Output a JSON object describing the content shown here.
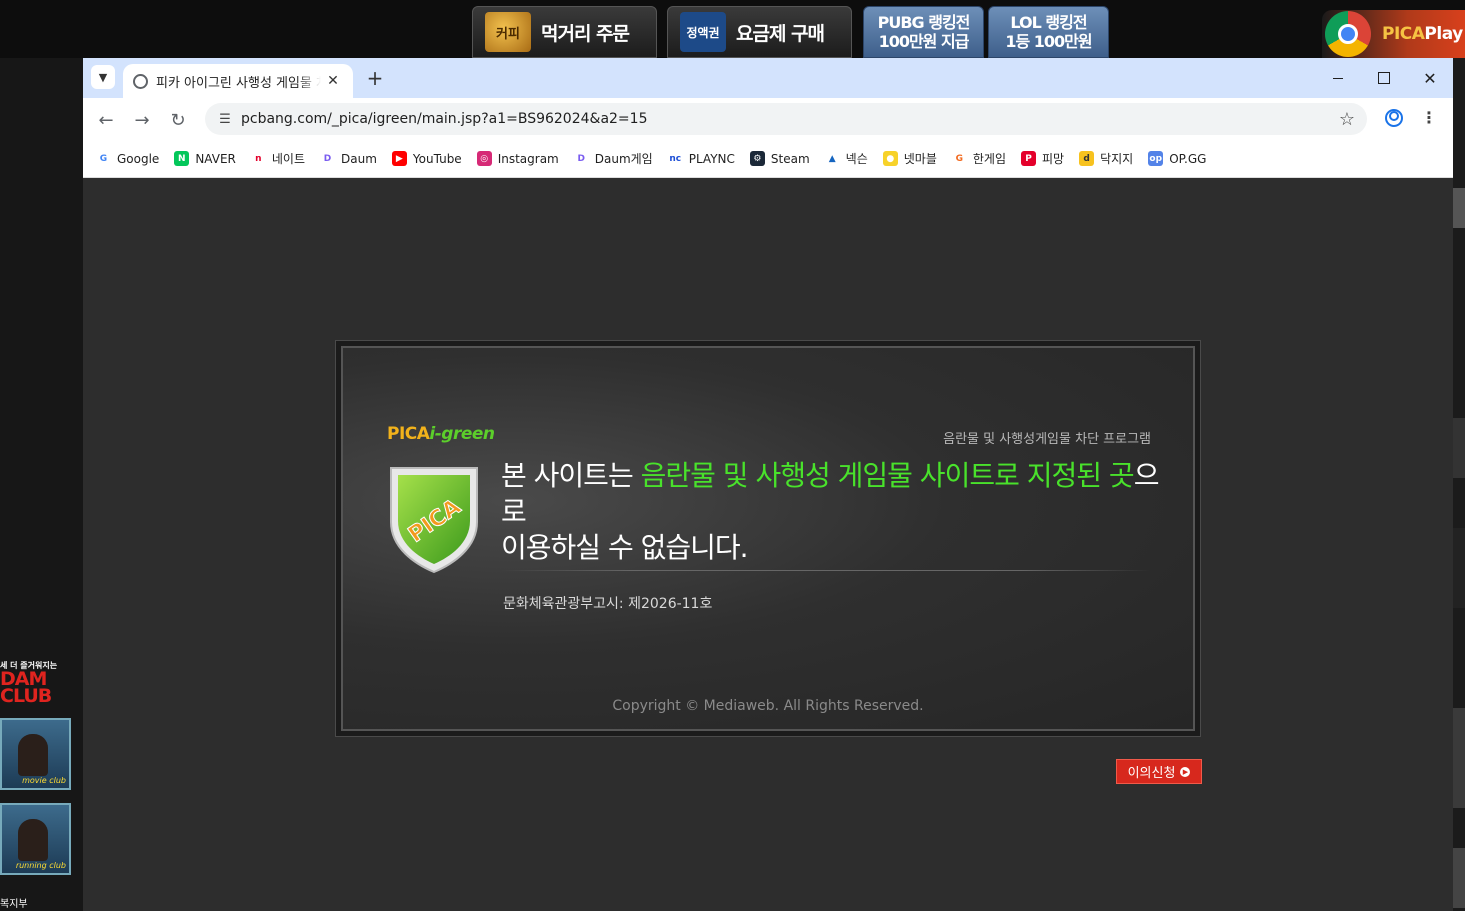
{
  "desktop": {
    "launcher": {
      "food_order_label": "먹거리 주문",
      "food_icon_text": "커피",
      "plan_purchase_label": "요금제 구매",
      "plan_icon_text": "정액권",
      "pubg_line1": "PUBG 랭킹전",
      "pubg_line2": "100만원 지급",
      "lol_line1": "LOL 랭킹전",
      "lol_line2": "1등 100만원",
      "picaplay_prefix": "PICA",
      "picaplay_suffix": "Play"
    },
    "left_ad": {
      "tagline": "세 더 즐거워지는",
      "title_line1": "DAM",
      "title_line2": "CLUB",
      "thumb1_caption": "movie club",
      "thumb2_caption": "running club",
      "bottom_text": "복지부"
    }
  },
  "browser": {
    "tab": {
      "title": "피카 아이그린 사행성 게임물 차단"
    },
    "address": {
      "url": "pcbang.com/_pica/igreen/main.jsp?a1=BS962024&a2=15"
    },
    "bookmarks": [
      {
        "label": "Google",
        "icon": "google-icon",
        "color": "#ffffff",
        "glyph": "G",
        "glyph_color": "#4285f4"
      },
      {
        "label": "NAVER",
        "icon": "naver-icon",
        "color": "#03c75a",
        "glyph": "N",
        "glyph_color": "#ffffff"
      },
      {
        "label": "네이트",
        "icon": "nate-icon",
        "color": "#ffffff",
        "glyph": "n",
        "glyph_color": "#e4002b"
      },
      {
        "label": "Daum",
        "icon": "daum-icon",
        "color": "#ffffff",
        "glyph": "D",
        "glyph_color": "#7a5cf0"
      },
      {
        "label": "YouTube",
        "icon": "youtube-icon",
        "color": "#ff0000",
        "glyph": "▶",
        "glyph_color": "#ffffff"
      },
      {
        "label": "Instagram",
        "icon": "instagram-icon",
        "color": "#d62976",
        "glyph": "◎",
        "glyph_color": "#ffffff"
      },
      {
        "label": "Daum게임",
        "icon": "daum-game-icon",
        "color": "#ffffff",
        "glyph": "D",
        "glyph_color": "#7a5cf0"
      },
      {
        "label": "PLAYNC",
        "icon": "plaync-icon",
        "color": "#ffffff",
        "glyph": "nc",
        "glyph_color": "#1d4fd6"
      },
      {
        "label": "Steam",
        "icon": "steam-icon",
        "color": "#1b2838",
        "glyph": "⚙",
        "glyph_color": "#ffffff"
      },
      {
        "label": "넥슨",
        "icon": "nexon-icon",
        "color": "#ffffff",
        "glyph": "▲",
        "glyph_color": "#1565c0"
      },
      {
        "label": "넷마블",
        "icon": "netmarble-icon",
        "color": "#f7d22a",
        "glyph": "●",
        "glyph_color": "#ffffff"
      },
      {
        "label": "한게임",
        "icon": "hangame-icon",
        "color": "#ffffff",
        "glyph": "G",
        "glyph_color": "#f26b21"
      },
      {
        "label": "피망",
        "icon": "pmang-icon",
        "color": "#e4002b",
        "glyph": "P",
        "glyph_color": "#ffffff"
      },
      {
        "label": "닥지지",
        "icon": "dakgg-icon",
        "color": "#f7c21e",
        "glyph": "d",
        "glyph_color": "#333333"
      },
      {
        "label": "OP.GG",
        "icon": "opgg-icon",
        "color": "#5383e8",
        "glyph": "op",
        "glyph_color": "#ffffff"
      }
    ]
  },
  "page": {
    "logo_prefix": "PICA",
    "logo_suffix": "i-green",
    "program_label": "음란물 및 사행성게임물 차단 프로그램",
    "shield_text": "PICA",
    "message_prefix": "본 사이트는 ",
    "message_highlight": "음란물 및 사행성 게임물 사이트로 지정된 곳",
    "message_suffix": "으로",
    "message_line2": "이용하실 수 없습니다.",
    "notice": "문화체육관광부고시: 제2026-11호",
    "copyright": "Copyright © Mediaweb. All Rights Reserved.",
    "appeal_label": "이의신청",
    "colors": {
      "highlight": "#49e22b",
      "appeal": "#d7281d",
      "logo_orange": "#f2b21b",
      "logo_green": "#5ccf2b"
    }
  }
}
